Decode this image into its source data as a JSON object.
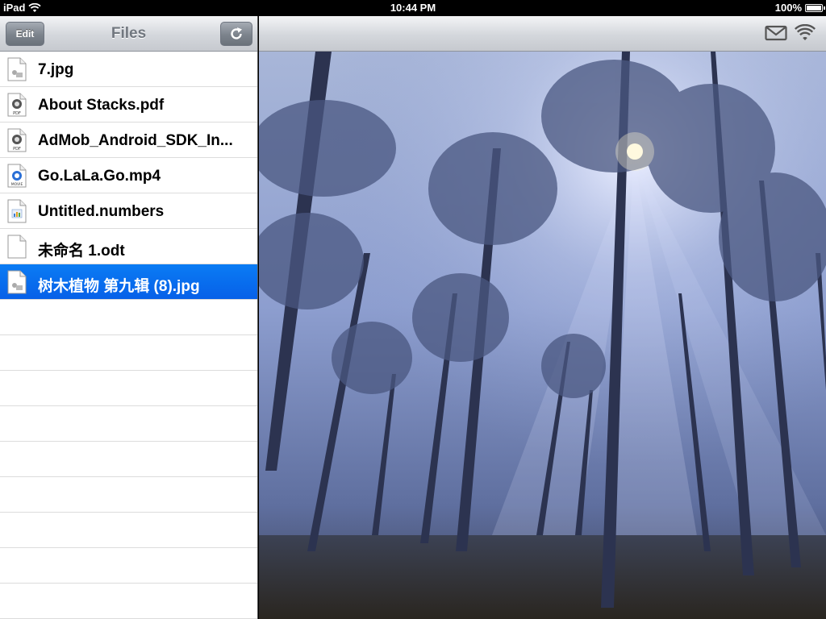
{
  "status_bar": {
    "device": "iPad",
    "time": "10:44 PM",
    "battery": "100%"
  },
  "sidebar": {
    "title": "Files",
    "edit_label": "Edit",
    "refresh_icon": "refresh-icon",
    "files": [
      {
        "name": "7.jpg",
        "icon": "image-file-icon"
      },
      {
        "name": "About Stacks.pdf",
        "icon": "pdf-file-icon"
      },
      {
        "name": "AdMob_Android_SDK_In...",
        "icon": "pdf-file-icon"
      },
      {
        "name": "Go.LaLa.Go.mp4",
        "icon": "movie-file-icon"
      },
      {
        "name": "Untitled.numbers",
        "icon": "numbers-file-icon"
      },
      {
        "name": "未命名 1.odt",
        "icon": "document-file-icon"
      },
      {
        "name": "树木植物 第九辑 (8).jpg",
        "icon": "image-file-icon",
        "selected": true
      }
    ]
  },
  "viewer": {
    "mail_icon": "mail-icon",
    "wifi_icon": "wifi-share-icon",
    "content": "forest-photo"
  },
  "colors": {
    "selection": "#0a6ff0",
    "navbar_top": "#f3f4f6",
    "navbar_bottom": "#c6c9cf"
  }
}
